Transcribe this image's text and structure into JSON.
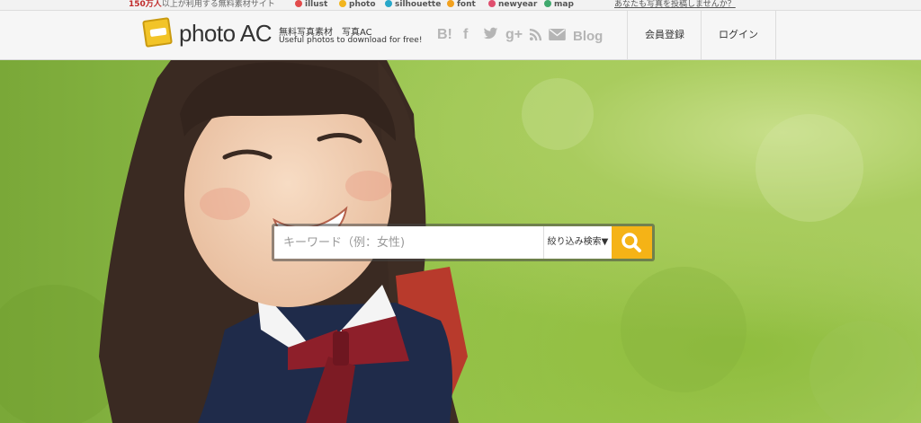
{
  "topbar": {
    "users_count": "150万人",
    "users_text": "以上が利用する無料素材サイト",
    "sites": [
      {
        "icon": "illust-icon",
        "label": "illust",
        "color": "#e24b4b"
      },
      {
        "icon": "photo-icon",
        "label": "photo",
        "color": "#f2b51e"
      },
      {
        "icon": "silhouette-icon",
        "label": "silhouette",
        "color": "#27a7c9"
      },
      {
        "icon": "font-icon",
        "label": "font",
        "color": "#f2a11e"
      },
      {
        "icon": "newyear-icon",
        "label": "newyear",
        "color": "#e04e6e"
      },
      {
        "icon": "map-icon",
        "label": "map",
        "color": "#3fa86d"
      }
    ],
    "invite": "あなたも写真を投稿しませんか？"
  },
  "header": {
    "logo_text": "photo",
    "logo_ac": "AC",
    "logo_badge": "photo",
    "tagline_jp": "無料写真素材　写真AC",
    "tagline_en": "Useful photos to download for free!",
    "social": [
      "B!",
      "f",
      "twitter",
      "g+",
      "rss",
      "mail"
    ],
    "blog": "Blog",
    "register": "会員登録",
    "login": "ログイン"
  },
  "search": {
    "placeholder": "キーワード（例：女性)",
    "filter_label": "絞り込み検索▼"
  },
  "colors": {
    "accent": "#f5b316",
    "count_red": "#c02a2a"
  }
}
